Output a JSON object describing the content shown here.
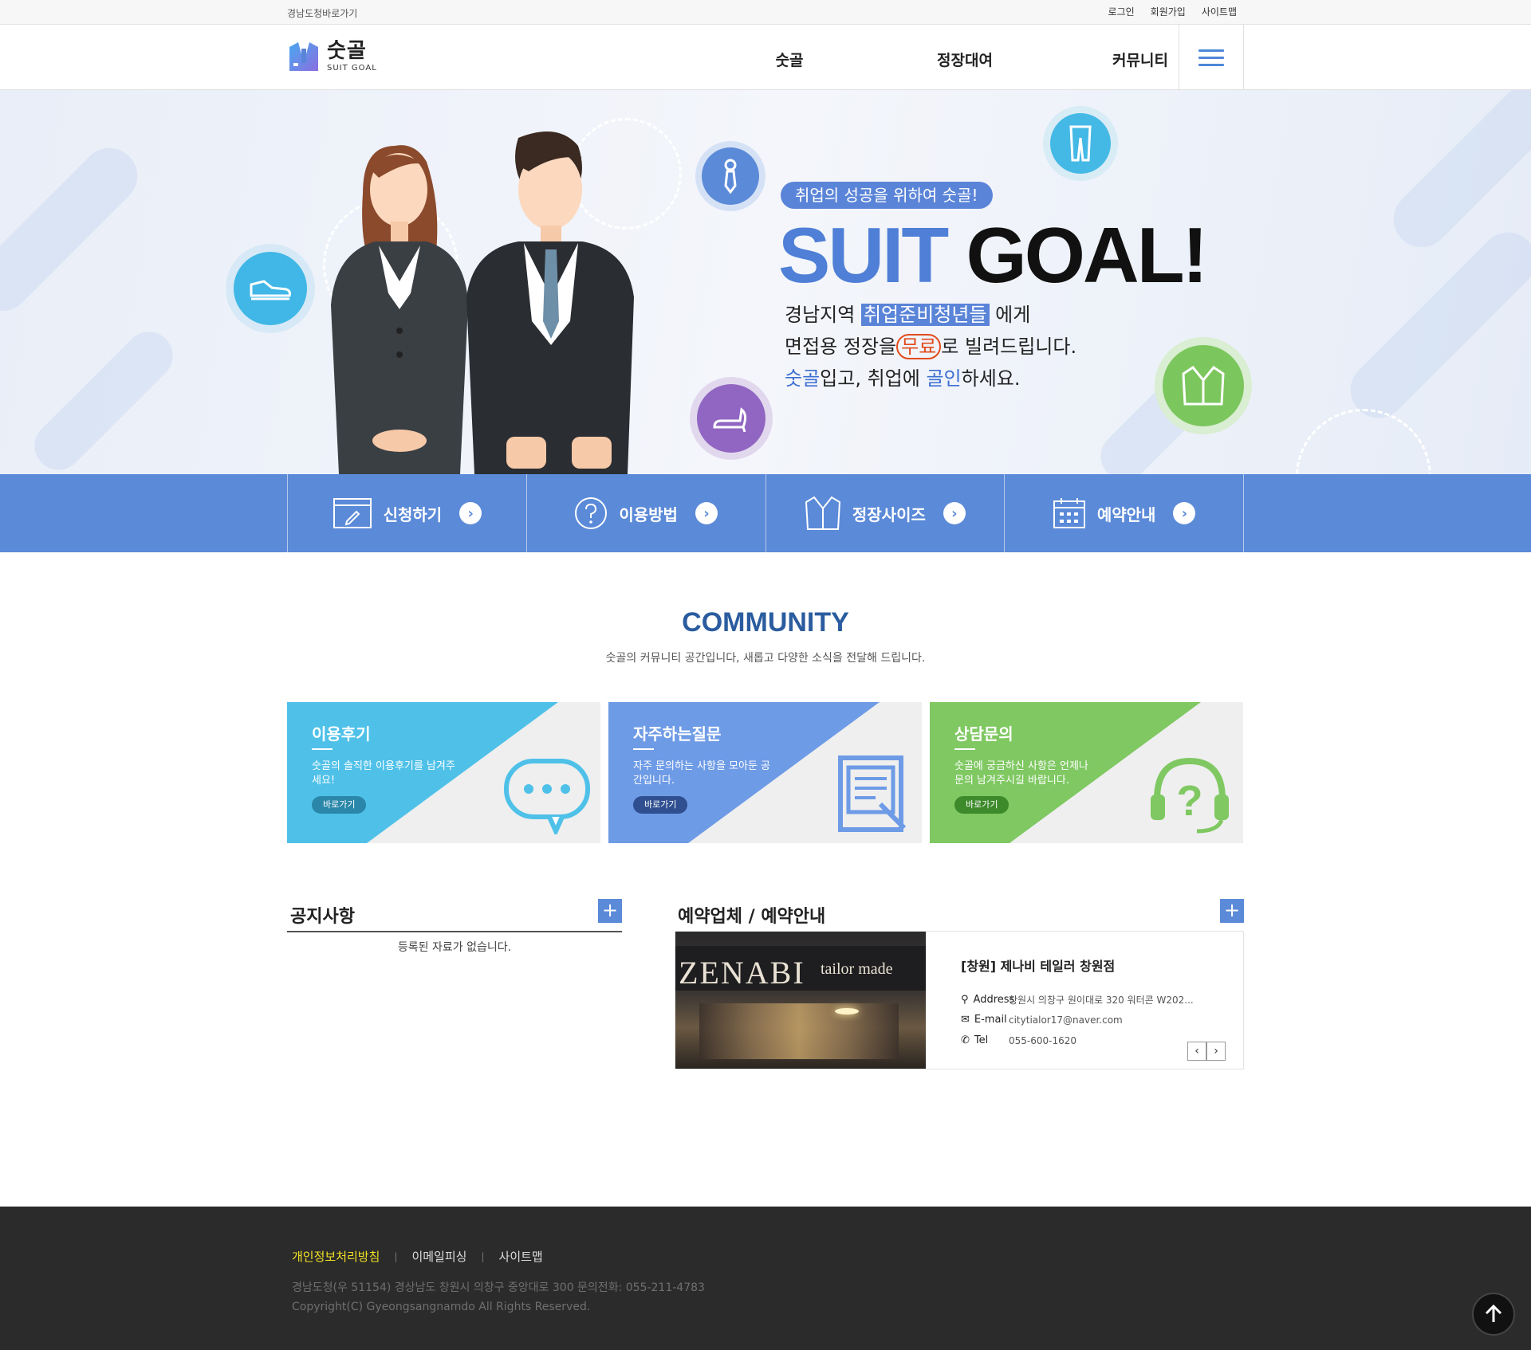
{
  "topbar": {
    "gov_link": "경남도청바로가기",
    "login": "로그인",
    "join": "회원가입",
    "sitemap": "사이트맵"
  },
  "header": {
    "logo_title": "숫골",
    "logo_sub": "SUIT GOAL",
    "nav": [
      "숫골",
      "정장대여",
      "커뮤니티"
    ]
  },
  "hero": {
    "badge": "취업의 성공을 위하여  숫골!",
    "title_part1": "SUIT",
    "title_part2": "GOAL!",
    "line1_a": "경남지역 ",
    "line1_hl": "취업준비청년들",
    "line1_b": " 에게",
    "line2_a": "면접용 정장을",
    "line2_free": "무료",
    "line2_b": "로 빌려드립니다.",
    "line3_a": "숫골",
    "line3_b": "입고, 취업에 ",
    "line3_c": "골인",
    "line3_d": "하세요."
  },
  "quick": [
    {
      "label": "신청하기",
      "icon": "application-form-icon"
    },
    {
      "label": "이용방법",
      "icon": "question-circle-icon"
    },
    {
      "label": "정장사이즈",
      "icon": "jacket-icon"
    },
    {
      "label": "예약안내",
      "icon": "calendar-icon"
    }
  ],
  "community": {
    "title": "COMMUNITY",
    "subtitle": "숫골의 커뮤니티 공간입니다, 새롭고 다양한 소식을 전달해 드립니다.",
    "cards": [
      {
        "title": "이용후기",
        "desc": "숫골의 솔직한 이용후기를 남겨주세요!",
        "button": "바로가기",
        "color": "#4fc1e9",
        "btn_color": "#2a87a9",
        "icon": "speech-bubble-icon"
      },
      {
        "title": "자주하는질문",
        "desc": "자주 문의하는 사항을 모아둔 공간입니다.",
        "button": "바로가기",
        "color": "#6e9be6",
        "btn_color": "#2f4f90",
        "icon": "document-edit-icon"
      },
      {
        "title": "상담문의",
        "desc": "숫골에 궁금하신 사항은 언제나 문의 남겨주시길 바랍니다.",
        "button": "바로가기",
        "color": "#7fc862",
        "btn_color": "#3d8a2a",
        "icon": "headset-question-icon"
      }
    ]
  },
  "notice": {
    "title": "공지사항",
    "empty": "등록된 자료가 없습니다."
  },
  "reservation": {
    "title": "예약업체 / 예약안내",
    "photo_brand": "ZENABI",
    "photo_brand_sub": "tailor made",
    "name": "[창원] 제나비 테일러 창원점",
    "address_label": "Address",
    "address": "창원시 의창구 원이대로 320 워터콘 W202...",
    "email_label": "E-mail",
    "email": "citytialor17@naver.com",
    "tel_label": "Tel",
    "tel": "055-600-1620",
    "prev": "‹",
    "next": "›"
  },
  "footer": {
    "privacy": "개인정보처리방침",
    "email_policy": "이메일피싱",
    "sitemap": "사이트맵",
    "address": "경남도청(우 51154) 경상남도 창원시 의창구 중앙대로 300 문의전화: 055-211-4783",
    "copyright": "Copyright(C) Gyeongsangnamdo All Rights Reserved."
  },
  "top_button_icon": "arrow-up-icon"
}
